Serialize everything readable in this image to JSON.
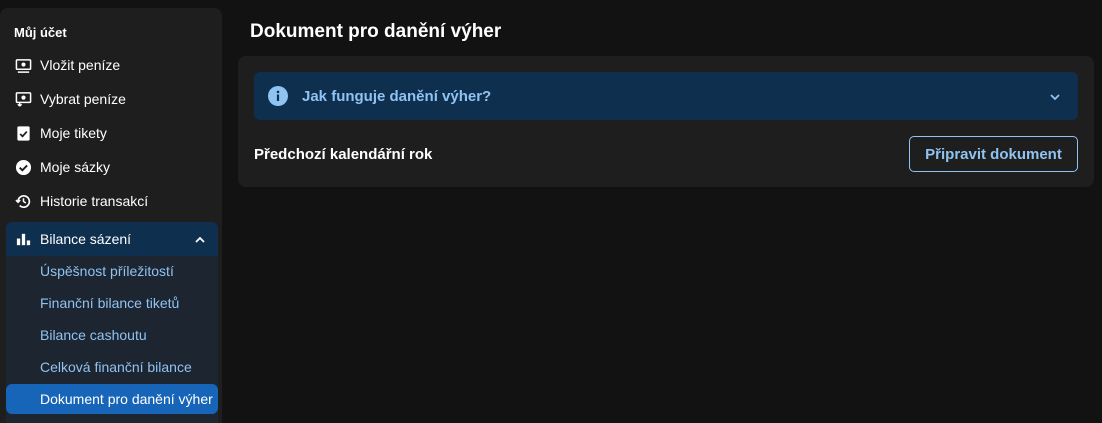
{
  "sidebar": {
    "title": "Můj účet",
    "items": [
      {
        "label": "Vložit peníze",
        "icon": "deposit-icon"
      },
      {
        "label": "Vybrat peníze",
        "icon": "withdraw-icon"
      },
      {
        "label": "Moje tikety",
        "icon": "tickets-icon"
      },
      {
        "label": "Moje sázky",
        "icon": "check-circle-icon"
      },
      {
        "label": "Historie transakcí",
        "icon": "history-icon"
      }
    ],
    "group": {
      "label": "Bilance sázení",
      "icon": "bar-chart-icon",
      "expanded": true,
      "items": [
        {
          "label": "Úspěšnost příležitostí"
        },
        {
          "label": "Finanční bilance tiketů"
        },
        {
          "label": "Bilance cashoutu"
        },
        {
          "label": "Celková finanční bilance"
        },
        {
          "label": "Dokument pro danění výher",
          "active": true
        }
      ]
    }
  },
  "main": {
    "title": "Dokument pro danění výher",
    "accordion": {
      "label": "Jak funguje danění výher?",
      "icon": "info-icon"
    },
    "row": {
      "label": "Předchozí kalendářní rok",
      "button": "Připravit dokument"
    }
  },
  "colors": {
    "background": "#121212",
    "panel": "#1e1e1e",
    "accent_dark": "#0f2f4e",
    "accent_text": "#8fc3f2",
    "active": "#1765b8"
  }
}
